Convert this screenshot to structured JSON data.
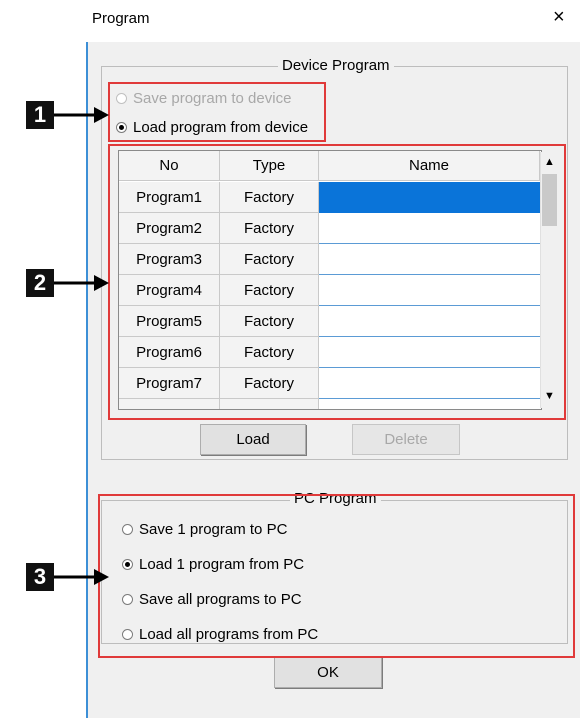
{
  "window": {
    "title": "Program",
    "close_glyph": "×"
  },
  "device_program": {
    "legend": "Device Program",
    "options": [
      {
        "label": "Save program to device",
        "selected": false,
        "enabled": false
      },
      {
        "label": "Load program from device",
        "selected": true,
        "enabled": true
      }
    ],
    "table": {
      "columns": [
        "No",
        "Type",
        "Name"
      ],
      "rows": [
        {
          "no": "Program1",
          "type": "Factory",
          "name": "",
          "selected": true
        },
        {
          "no": "Program2",
          "type": "Factory",
          "name": ""
        },
        {
          "no": "Program3",
          "type": "Factory",
          "name": ""
        },
        {
          "no": "Program4",
          "type": "Factory",
          "name": ""
        },
        {
          "no": "Program5",
          "type": "Factory",
          "name": ""
        },
        {
          "no": "Program6",
          "type": "Factory",
          "name": ""
        },
        {
          "no": "Program7",
          "type": "Factory",
          "name": ""
        }
      ]
    },
    "load_button": "Load",
    "delete_button": "Delete"
  },
  "pc_program": {
    "legend": "PC Program",
    "options": [
      {
        "label": "Save 1 program to PC",
        "selected": false
      },
      {
        "label": "Load 1 program from PC",
        "selected": true
      },
      {
        "label": "Save all programs to PC",
        "selected": false
      },
      {
        "label": "Load all programs from PC",
        "selected": false
      }
    ]
  },
  "ok_button": "OK",
  "callouts": [
    "1",
    "2",
    "3"
  ],
  "colors": {
    "selection": "#0a74d9",
    "annotation_red": "#e03a3a",
    "grid_line": "#5b9bd5"
  }
}
